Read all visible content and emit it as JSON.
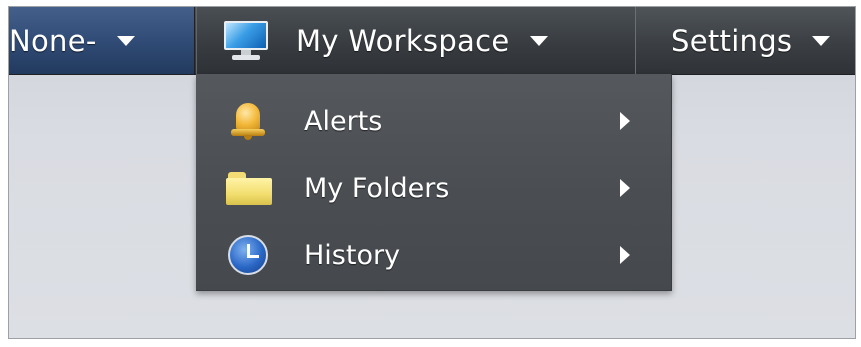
{
  "menubar": {
    "items": [
      {
        "label": "None-",
        "icon": "",
        "has_caret": true,
        "state": "active-blue"
      },
      {
        "label": "My Workspace",
        "icon": "monitor-icon",
        "has_caret": true,
        "state": "open"
      },
      {
        "label": "Settings",
        "icon": "",
        "has_caret": true,
        "state": "normal"
      }
    ]
  },
  "dropdown": {
    "items": [
      {
        "label": "Alerts",
        "icon": "bell-icon",
        "has_submenu": true
      },
      {
        "label": "My Folders",
        "icon": "folder-icon",
        "has_submenu": true
      },
      {
        "label": "History",
        "icon": "clock-icon",
        "has_submenu": true
      }
    ]
  },
  "colors": {
    "menubar_bg": "#3b3f43",
    "none_item_bg": "#2f4a74",
    "dropdown_bg": "#4b4f53",
    "page_bg": "#d9dce2",
    "text": "#ffffff"
  }
}
